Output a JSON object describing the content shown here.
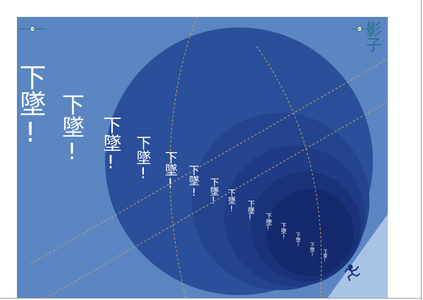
{
  "poster": {
    "title": "影子",
    "fall_texts": [
      "下墜!",
      "下墜!",
      "下墜!",
      "下墜!",
      "下墜!",
      "下墜!",
      "下墜!",
      "下墜!",
      "下墜!",
      "下墜!",
      "下墜!",
      "下墜!",
      "下墜!",
      "下墜!"
    ]
  },
  "colors": {
    "background": "#5b86c2",
    "circle_large": "#2b4f9b",
    "circle_mid1": "#24448f",
    "circle_mid2": "#1f3b85",
    "circle_mid3": "#1a327a",
    "circle_small": "#152a6c",
    "text": "#ffffff",
    "dashed_line": "#c8a659",
    "accent": "#2a6f86"
  },
  "icons": {
    "figure": "falling-figure-icon",
    "marker_left": "target-marker-icon",
    "marker_right": "target-marker-icon"
  }
}
